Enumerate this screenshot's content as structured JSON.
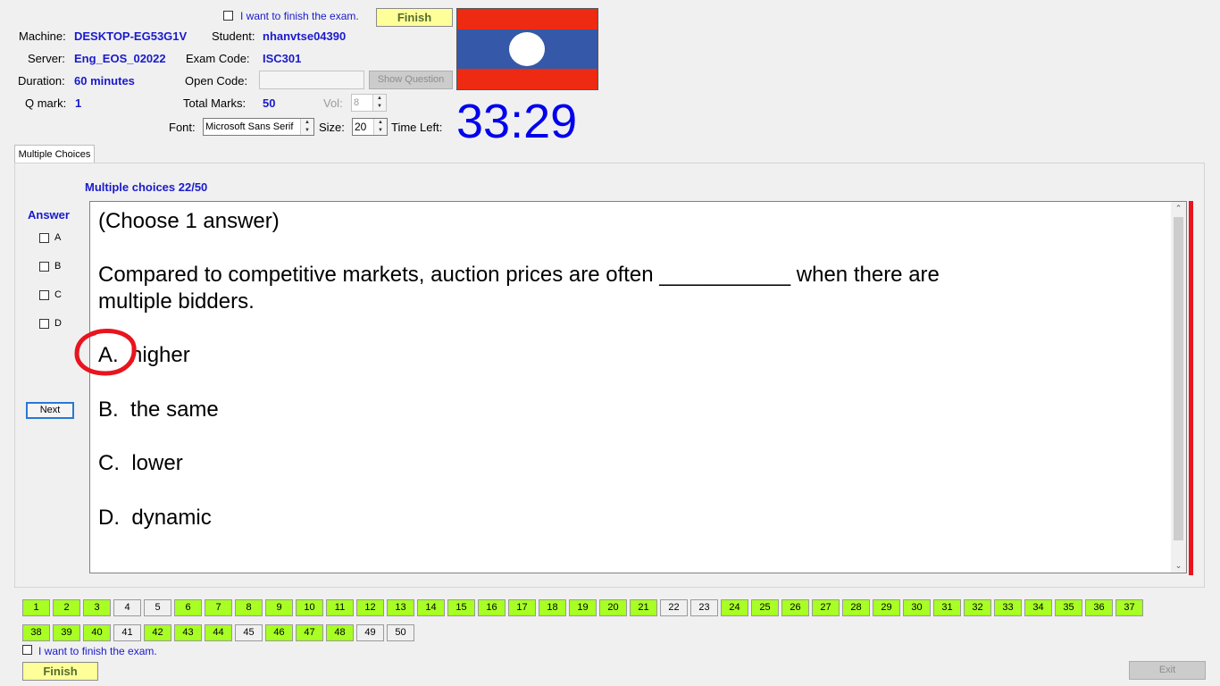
{
  "header": {
    "finish_checkbox_label": "I want to finish the exam.",
    "finish_button": "Finish",
    "machine_label": "Machine:",
    "machine_value": "DESKTOP-EG53G1V",
    "student_label": "Student:",
    "student_value": "nhanvtse04390",
    "server_label": "Server:",
    "server_value": "Eng_EOS_02022",
    "exam_code_label": "Exam Code:",
    "exam_code_value": "ISC301",
    "duration_label": "Duration:",
    "duration_value": "60 minutes",
    "open_code_label": "Open Code:",
    "open_code_value": "",
    "show_question_button": "Show Question",
    "qmark_label": "Q mark:",
    "qmark_value": "1",
    "total_marks_label": "Total Marks:",
    "total_marks_value": "50",
    "vol_label": "Vol:",
    "vol_value": "8",
    "font_label": "Font:",
    "font_value": "Microsoft Sans Serif",
    "size_label": "Size:",
    "size_value": "20",
    "time_left_label": "Time Left:",
    "time_left_value": "33:29",
    "flag_icon": "laos-flag-icon"
  },
  "tabs": [
    "Multiple Choices"
  ],
  "question": {
    "heading": "Multiple choices 22/50",
    "instruction": "(Choose 1 answer)",
    "stem_line1": "Compared to competitive markets, auction prices are often ___________ when there are",
    "stem_line2": "multiple bidders.",
    "options": [
      {
        "letter": "A.",
        "text": "higher"
      },
      {
        "letter": "B.",
        "text": "the same"
      },
      {
        "letter": "C.",
        "text": "lower"
      },
      {
        "letter": "D.",
        "text": "dynamic"
      }
    ]
  },
  "answer_panel": {
    "title": "Answer",
    "choices": [
      "A",
      "B",
      "C",
      "D"
    ],
    "next_button": "Next"
  },
  "question_nav": {
    "row1": [
      {
        "n": "1",
        "done": true
      },
      {
        "n": "2",
        "done": true
      },
      {
        "n": "3",
        "done": true
      },
      {
        "n": "4",
        "done": false
      },
      {
        "n": "5",
        "done": false
      },
      {
        "n": "6",
        "done": true
      },
      {
        "n": "7",
        "done": true
      },
      {
        "n": "8",
        "done": true
      },
      {
        "n": "9",
        "done": true
      },
      {
        "n": "10",
        "done": true
      },
      {
        "n": "11",
        "done": true
      },
      {
        "n": "12",
        "done": true
      },
      {
        "n": "13",
        "done": true
      },
      {
        "n": "14",
        "done": true
      },
      {
        "n": "15",
        "done": true
      },
      {
        "n": "16",
        "done": true
      },
      {
        "n": "17",
        "done": true
      },
      {
        "n": "18",
        "done": true
      },
      {
        "n": "19",
        "done": true
      },
      {
        "n": "20",
        "done": true
      },
      {
        "n": "21",
        "done": true
      },
      {
        "n": "22",
        "done": false
      },
      {
        "n": "23",
        "done": false
      },
      {
        "n": "24",
        "done": true
      },
      {
        "n": "25",
        "done": true
      },
      {
        "n": "26",
        "done": true
      },
      {
        "n": "27",
        "done": true
      },
      {
        "n": "28",
        "done": true
      },
      {
        "n": "29",
        "done": true
      },
      {
        "n": "30",
        "done": true
      },
      {
        "n": "31",
        "done": true
      },
      {
        "n": "32",
        "done": true
      },
      {
        "n": "33",
        "done": true
      },
      {
        "n": "34",
        "done": true
      },
      {
        "n": "35",
        "done": true
      },
      {
        "n": "36",
        "done": true
      },
      {
        "n": "37",
        "done": true
      }
    ],
    "row2": [
      {
        "n": "38",
        "done": true
      },
      {
        "n": "39",
        "done": true
      },
      {
        "n": "40",
        "done": true
      },
      {
        "n": "41",
        "done": false
      },
      {
        "n": "42",
        "done": true
      },
      {
        "n": "43",
        "done": true
      },
      {
        "n": "44",
        "done": true
      },
      {
        "n": "45",
        "done": false
      },
      {
        "n": "46",
        "done": true
      },
      {
        "n": "47",
        "done": true
      },
      {
        "n": "48",
        "done": true
      },
      {
        "n": "49",
        "done": false
      },
      {
        "n": "50",
        "done": false
      }
    ]
  },
  "footer": {
    "finish_checkbox_label": "I want to finish the exam.",
    "finish_button": "Finish",
    "exit_button": "Exit"
  },
  "colors": {
    "answered": "#a8ff24",
    "accent_blue": "#1a1acc",
    "timer_blue": "#0000ee",
    "annotation_red": "#e8141e"
  }
}
